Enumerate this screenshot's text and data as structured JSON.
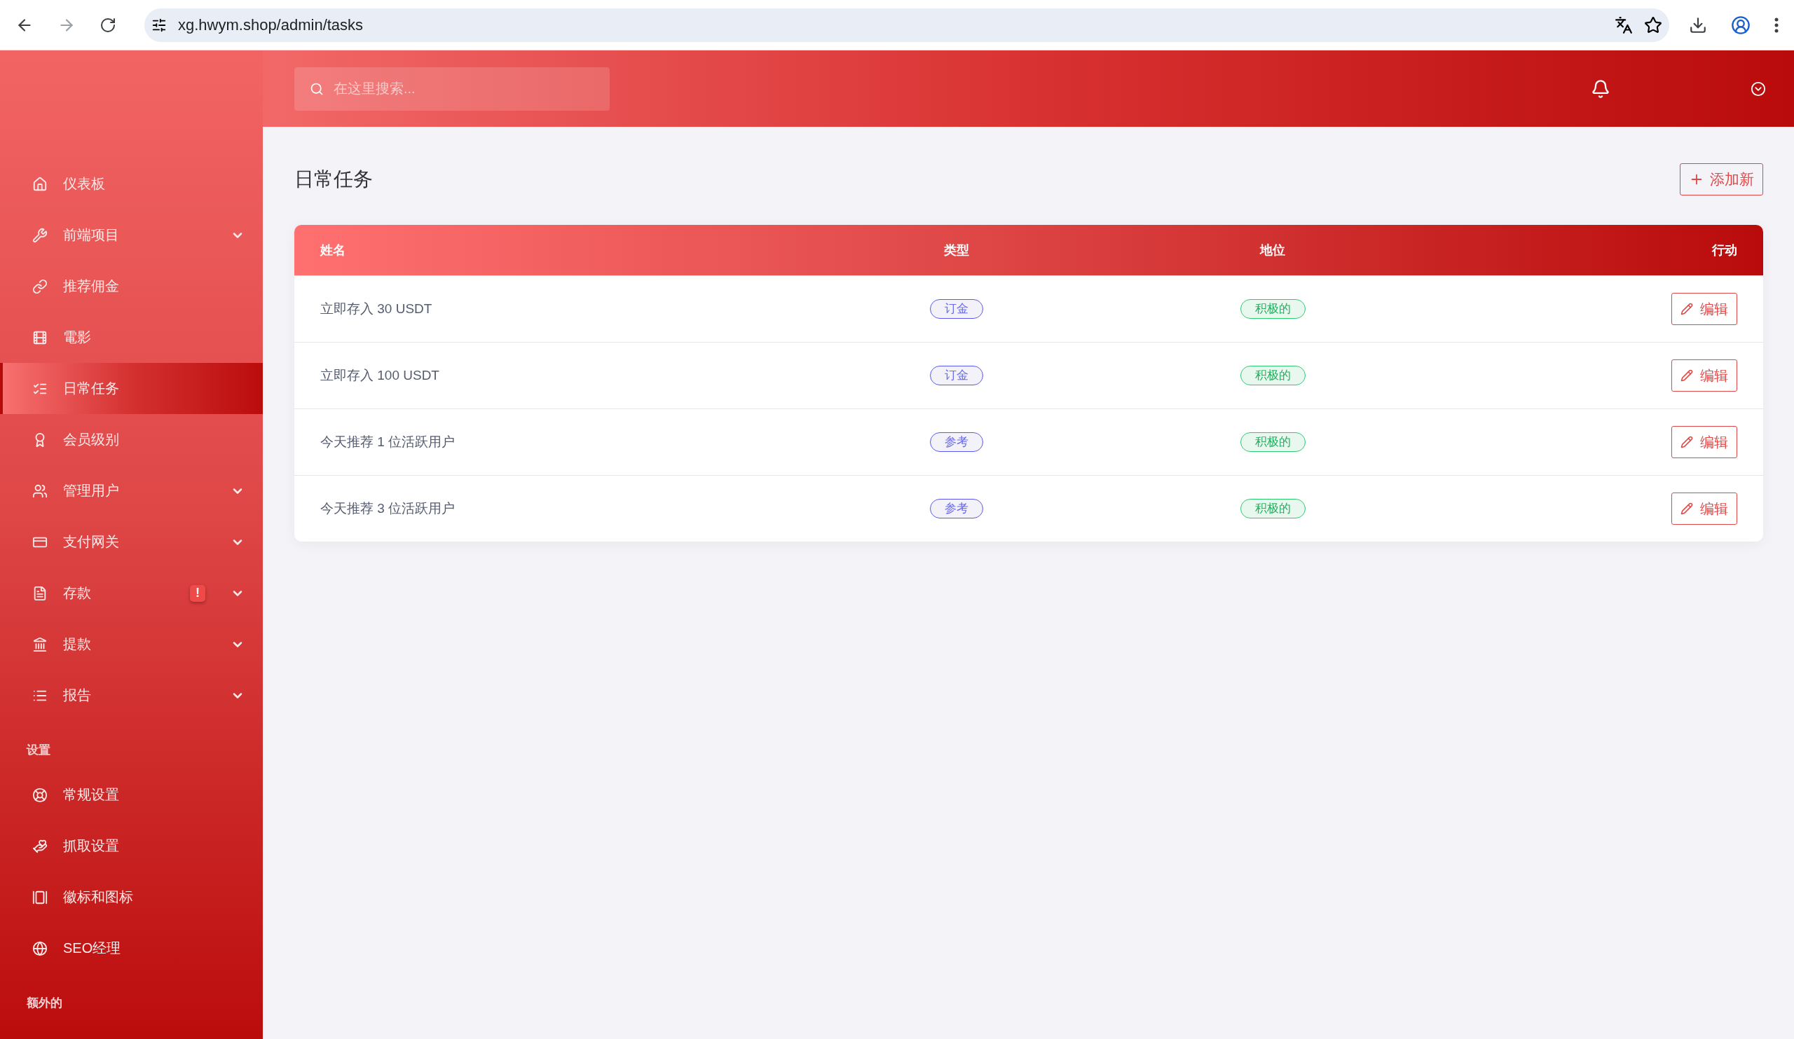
{
  "browser": {
    "url": "xg.hwym.shop/admin/tasks"
  },
  "header": {
    "search": {
      "placeholder": "在这里搜索..."
    }
  },
  "sidebar": {
    "sections": [
      {
        "items": [
          {
            "label": "仪表板",
            "has_submenu": false,
            "selected": false
          },
          {
            "label": "前端项目",
            "has_submenu": true,
            "selected": false
          },
          {
            "label": "推荐佣金",
            "has_submenu": false,
            "selected": false
          },
          {
            "label": "電影",
            "has_submenu": false,
            "selected": false
          },
          {
            "label": "日常任务",
            "has_submenu": false,
            "selected": true
          },
          {
            "label": "会员级别",
            "has_submenu": false,
            "selected": false
          },
          {
            "label": "管理用户",
            "has_submenu": true,
            "selected": false
          },
          {
            "label": "支付网关",
            "has_submenu": true,
            "selected": false
          },
          {
            "label": "存款",
            "has_submenu": true,
            "selected": false,
            "badge": "!"
          },
          {
            "label": "提款",
            "has_submenu": true,
            "selected": false
          },
          {
            "label": "报告",
            "has_submenu": true,
            "selected": false
          }
        ]
      },
      {
        "title": "设置",
        "items": [
          {
            "label": "常规设置",
            "has_submenu": false,
            "selected": false
          },
          {
            "label": "抓取设置",
            "has_submenu": false,
            "selected": false
          },
          {
            "label": "徽标和图标",
            "has_submenu": false,
            "selected": false
          },
          {
            "label": "SEO经理",
            "has_submenu": false,
            "selected": false
          }
        ]
      },
      {
        "title": "额外的"
      }
    ]
  },
  "page": {
    "title": "日常任务",
    "add_button": "添加新"
  },
  "table": {
    "columns": [
      "姓名",
      "类型",
      "地位",
      "行动"
    ],
    "rows": [
      {
        "name": "立即存入 30 USDT",
        "type": {
          "label": "订金",
          "kind": "type"
        },
        "status": {
          "label": "积极的",
          "kind": "status"
        },
        "action": "编辑"
      },
      {
        "name": "立即存入 100 USDT",
        "type": {
          "label": "订金",
          "kind": "type"
        },
        "status": {
          "label": "积极的",
          "kind": "status"
        },
        "action": "编辑"
      },
      {
        "name": "今天推荐 1 位活跃用户",
        "type": {
          "label": "参考",
          "kind": "type"
        },
        "status": {
          "label": "积极的",
          "kind": "status"
        },
        "action": "编辑"
      },
      {
        "name": "今天推荐 3 位活跃用户",
        "type": {
          "label": "参考",
          "kind": "type"
        },
        "status": {
          "label": "积极的",
          "kind": "status"
        },
        "action": "编辑"
      }
    ]
  }
}
